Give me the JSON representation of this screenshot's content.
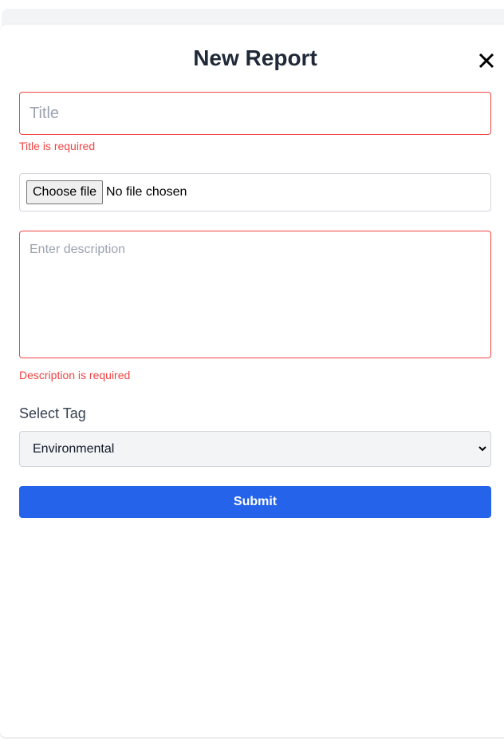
{
  "modal": {
    "title": "New Report",
    "close_icon": "close-icon"
  },
  "form": {
    "title_placeholder": "Title",
    "title_value": "",
    "title_error": "Title is required",
    "file_button_label": "Choose file",
    "file_status": "No file chosen",
    "description_placeholder": "Enter description",
    "description_value": "",
    "description_error": "Description is required",
    "tag_label": "Select Tag",
    "tag_selected": "Environmental",
    "submit_label": "Submit"
  },
  "colors": {
    "accent": "#2563eb",
    "error": "#ef4444",
    "heading": "#1f2937"
  }
}
